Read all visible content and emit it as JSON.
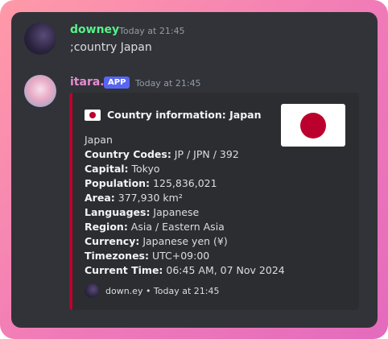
{
  "messages": [
    {
      "author": "downey",
      "timestamp": "Today at 21:45",
      "content": ";country Japan",
      "color": "#57f287"
    },
    {
      "author": "itara.",
      "badge": "APP",
      "timestamp": "Today at 21:45",
      "color": "#e98bd3"
    }
  ],
  "embed": {
    "title": "Country information: Japan",
    "title_icon": "japan-flag-icon",
    "accent_color": "#bc002d",
    "intro": "Japan",
    "fields": [
      {
        "label": "Country Codes:",
        "value": " JP / JPN / 392"
      },
      {
        "label": "Capital:",
        "value": " Tokyo"
      },
      {
        "label": "Population:",
        "value": " 125,836,021"
      },
      {
        "label": "Area:",
        "value": " 377,930 km²"
      },
      {
        "label": "Languages:",
        "value": " Japanese"
      },
      {
        "label": "Region:",
        "value": " Asia / Eastern Asia"
      },
      {
        "label": "Currency:",
        "value": " Japanese yen (¥)"
      },
      {
        "label": "Timezones:",
        "value": " UTC+09:00"
      },
      {
        "label": "Current Time:",
        "value": " 06:45 AM, 07 Nov 2024"
      }
    ],
    "footer": "down.ey • Today at 21:45"
  }
}
